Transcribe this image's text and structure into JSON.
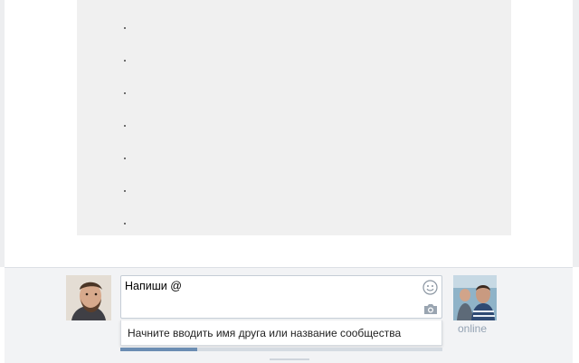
{
  "composer": {
    "input_value": "Напиши @",
    "suggestion": "Начните вводить имя друга или название сообщества",
    "friend_status": "online",
    "upload_progress": 0.24
  },
  "icons": {
    "smile": "smile-icon",
    "camera": "camera-icon"
  },
  "colors": {
    "page_bg": "#ffffff",
    "composer_bg": "#f2f3f5",
    "placeholder_block": "#f0f0f0",
    "online_text": "#93a2b3",
    "progress": "#6b8db3"
  }
}
